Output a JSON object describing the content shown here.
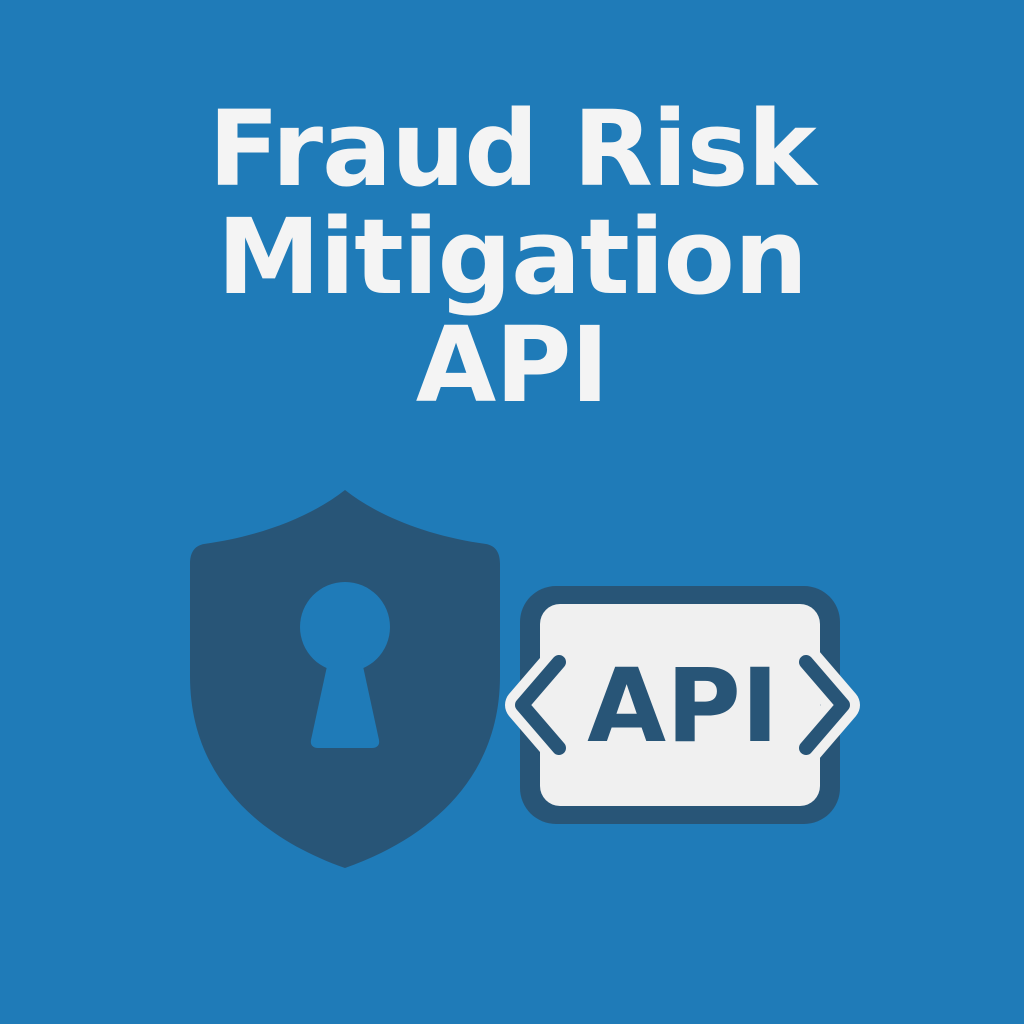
{
  "title": {
    "line1": "Fraud Risk",
    "line2": "Mitigation",
    "line3": "API"
  },
  "badge": {
    "label": "API"
  },
  "icons": {
    "shield": "shield-keyhole-icon",
    "api": "api-code-icon"
  },
  "colors": {
    "background": "#1f7bb8",
    "icon": "#285577",
    "text": "#f4f4f4",
    "badge_fill": "#f0f0f0"
  }
}
